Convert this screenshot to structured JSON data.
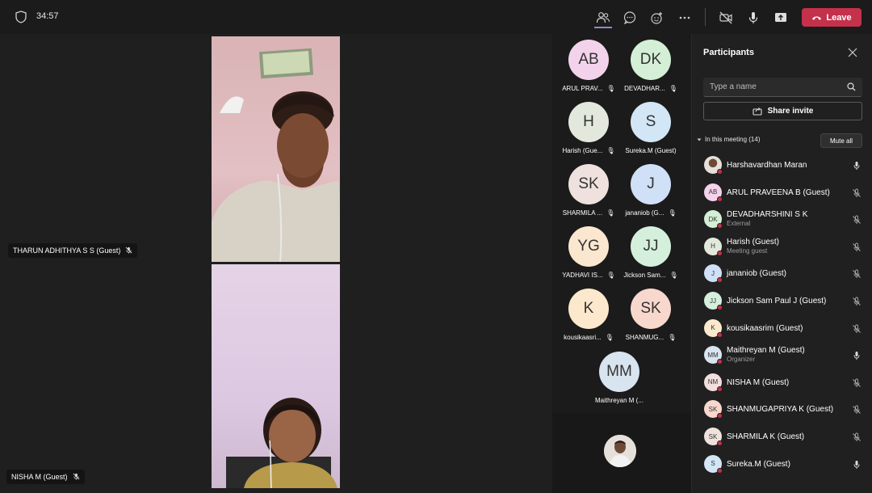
{
  "topbar": {
    "timer": "34:57",
    "leave_label": "Leave",
    "icons": [
      "people-icon",
      "chat-icon",
      "reactions-icon",
      "more-icon",
      "camera-off-icon",
      "mic-icon",
      "share-screen-icon"
    ]
  },
  "stage": {
    "videos": [
      {
        "name": "THARUN ADHITHYA S S (Guest)"
      },
      {
        "name": "NISHA M (Guest)"
      }
    ]
  },
  "grid": {
    "tiles": [
      {
        "initials": "AB",
        "name": "ARUL PRAV...",
        "color": "#f3d3ec"
      },
      {
        "initials": "DK",
        "name": "DEVADHAR...",
        "color": "#d4efd6"
      },
      {
        "initials": "H",
        "name": "Harish (Gue...",
        "color": "#e2e9dc"
      },
      {
        "initials": "S",
        "name": "Sureka.M (Guest)",
        "color": "#d3e6f5"
      },
      {
        "initials": "SK",
        "name": "SHARMILA ...",
        "color": "#efe1dd"
      },
      {
        "initials": "J",
        "name": "jananiob (G...",
        "color": "#cfe0f7"
      },
      {
        "initials": "YG",
        "name": "YADHAVI IS...",
        "color": "#fbe7cf"
      },
      {
        "initials": "JJ",
        "name": "Jickson Sam...",
        "color": "#d4f0dc"
      },
      {
        "initials": "K",
        "name": "kousikaasri...",
        "color": "#fce8cc"
      },
      {
        "initials": "SK",
        "name": "SHANMUG...",
        "color": "#f8d7cc"
      },
      {
        "initials": "MM",
        "name": "Maithreyan M (...",
        "color": "#d8e4ef"
      }
    ]
  },
  "panel": {
    "title": "Participants",
    "search_placeholder": "Type a name",
    "share_label": "Share invite",
    "section_label": "In this meeting (14)",
    "mute_all_label": "Mute all",
    "participants": [
      {
        "initials": "",
        "name": "Harshavardhan Maran",
        "sub": "",
        "color": "#d9d9d9",
        "mic": "on"
      },
      {
        "initials": "AB",
        "name": "ARUL PRAVEENA B (Guest)",
        "sub": "",
        "color": "#f3d3ec",
        "mic": "off"
      },
      {
        "initials": "DK",
        "name": "DEVADHARSHINI S K",
        "sub": "External",
        "color": "#d4efd6",
        "mic": "off"
      },
      {
        "initials": "H",
        "name": "Harish (Guest)",
        "sub": "Meeting guest",
        "color": "#e2e9dc",
        "mic": "off"
      },
      {
        "initials": "J",
        "name": "jananiob (Guest)",
        "sub": "",
        "color": "#cfe0f7",
        "mic": "off"
      },
      {
        "initials": "JJ",
        "name": "Jickson Sam Paul J (Guest)",
        "sub": "",
        "color": "#d4f0dc",
        "mic": "off"
      },
      {
        "initials": "K",
        "name": "kousikaasrim (Guest)",
        "sub": "",
        "color": "#fce8cc",
        "mic": "off"
      },
      {
        "initials": "MM",
        "name": "Maithreyan M (Guest)",
        "sub": "Organizer",
        "color": "#d8e4ef",
        "mic": "on"
      },
      {
        "initials": "NM",
        "name": "NISHA M (Guest)",
        "sub": "",
        "color": "#f3dede",
        "mic": "off"
      },
      {
        "initials": "SK",
        "name": "SHANMUGAPRIYA K (Guest)",
        "sub": "",
        "color": "#f8d7cc",
        "mic": "off"
      },
      {
        "initials": "SK",
        "name": "SHARMILA K (Guest)",
        "sub": "",
        "color": "#efe1dd",
        "mic": "off"
      },
      {
        "initials": "S",
        "name": "Sureka.M (Guest)",
        "sub": "",
        "color": "#d3e6f5",
        "mic": "on"
      }
    ]
  }
}
